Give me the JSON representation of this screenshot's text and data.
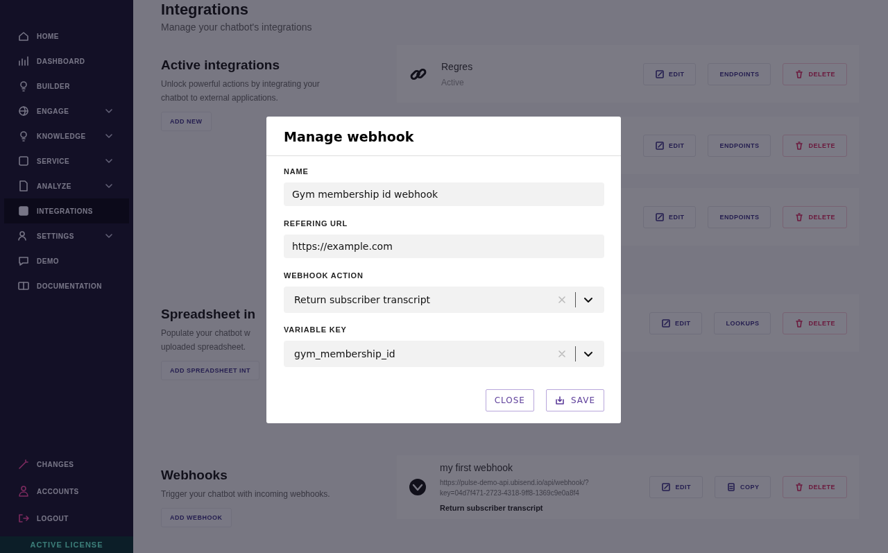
{
  "sidebar": {
    "items": [
      {
        "label": "HOME",
        "expandable": false,
        "selected": false
      },
      {
        "label": "DASHBOARD",
        "expandable": false,
        "selected": false
      },
      {
        "label": "BUILDER",
        "expandable": false,
        "selected": false
      },
      {
        "label": "ENGAGE",
        "expandable": true,
        "selected": false
      },
      {
        "label": "KNOWLEDGE",
        "expandable": true,
        "selected": false
      },
      {
        "label": "SERVICE",
        "expandable": true,
        "selected": false
      },
      {
        "label": "ANALYZE",
        "expandable": true,
        "selected": false
      },
      {
        "label": "INTEGRATIONS",
        "expandable": false,
        "selected": true
      },
      {
        "label": "SETTINGS",
        "expandable": true,
        "selected": false
      },
      {
        "label": "DEMO",
        "expandable": false,
        "selected": false
      },
      {
        "label": "DOCUMENTATION",
        "expandable": false,
        "selected": false
      }
    ],
    "bottom_items": [
      {
        "label": "CHANGES"
      },
      {
        "label": "ACCOUNTS"
      },
      {
        "label": "LOGOUT"
      }
    ],
    "license": "ACTIVE LICENSE"
  },
  "page": {
    "title": "Integrations",
    "subtitle": "Manage your chatbot's integrations"
  },
  "sections": [
    {
      "title": "Active integrations",
      "description_lines": [
        "Unlock powerful actions by integrating your",
        "chatbot to external applications."
      ],
      "action": "ADD NEW",
      "cards": [
        {
          "title": "Regres",
          "status": "Active",
          "buttons": [
            {
              "label": "EDIT",
              "kind": "edit"
            },
            {
              "label": "ENDPOINTS",
              "kind": "plain"
            },
            {
              "label": "DELETE",
              "kind": "delete"
            }
          ]
        },
        {
          "buttons": [
            {
              "label": "EDIT",
              "kind": "edit"
            },
            {
              "label": "ENDPOINTS",
              "kind": "plain"
            },
            {
              "label": "DELETE",
              "kind": "delete"
            }
          ]
        },
        {
          "buttons": [
            {
              "label": "EDIT",
              "kind": "edit"
            },
            {
              "label": "ENDPOINTS",
              "kind": "plain"
            },
            {
              "label": "DELETE",
              "kind": "delete"
            }
          ]
        }
      ]
    },
    {
      "title": "Spreadsheet in",
      "description_lines": [
        "Populate your chatbot w",
        "uploaded spreadsheet."
      ],
      "action": "ADD SPREADSHEET INT",
      "cards": [
        {
          "buttons": [
            {
              "label": "EDIT",
              "kind": "edit"
            },
            {
              "label": "LOOKUPS",
              "kind": "plain"
            },
            {
              "label": "DELETE",
              "kind": "delete"
            }
          ]
        }
      ]
    },
    {
      "title": "Webhooks",
      "description_lines": [
        "Trigger your chatbot with incoming webhooks."
      ],
      "action": "ADD WEBHOOK",
      "cards": [
        {
          "title": "my first webhook",
          "url_lines": [
            "https://pulse-demo-api.ubisend.io/api/webhook/?",
            "key=04d7f471-2723-4318-9ff8-1369c9e0a8f4"
          ],
          "detail": "Return subscriber transcript",
          "buttons": [
            {
              "label": "EDIT",
              "kind": "edit"
            },
            {
              "label": "COPY",
              "kind": "copy"
            },
            {
              "label": "DELETE",
              "kind": "delete"
            }
          ]
        }
      ]
    }
  ],
  "modal": {
    "title": "Manage webhook",
    "fields": [
      {
        "label": "NAME",
        "kind": "text",
        "value": "Gym membership id webhook"
      },
      {
        "label": "REFERING URL",
        "kind": "text",
        "value": "https://example.com"
      },
      {
        "label": "WEBHOOK ACTION",
        "kind": "select",
        "value": "Return subscriber transcript"
      },
      {
        "label": "VARIABLE KEY",
        "kind": "select",
        "value": "gym_membership_id"
      }
    ],
    "buttons": [
      {
        "label": "CLOSE",
        "kind": "close"
      },
      {
        "label": "SAVE",
        "kind": "save"
      }
    ]
  }
}
